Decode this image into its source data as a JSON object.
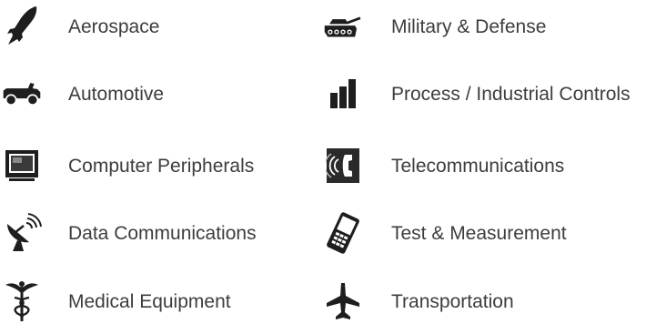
{
  "industries": {
    "left": [
      {
        "label": "Aerospace",
        "icon": "rocket-icon"
      },
      {
        "label": "Automotive",
        "icon": "car-icon"
      },
      {
        "label": "Computer Peripherals",
        "icon": "monitor-icon"
      },
      {
        "label": "Data Communications",
        "icon": "satellite-dish-icon"
      },
      {
        "label": "Medical Equipment",
        "icon": "caduceus-icon"
      }
    ],
    "right": [
      {
        "label": "Military & Defense",
        "icon": "tank-icon"
      },
      {
        "label": "Process / Industrial Controls",
        "icon": "bar-chart-icon"
      },
      {
        "label": "Telecommunications",
        "icon": "phone-icon"
      },
      {
        "label": "Test & Measurement",
        "icon": "handheld-meter-icon"
      },
      {
        "label": "Transportation",
        "icon": "airplane-icon"
      }
    ]
  },
  "colors": {
    "icon": "#1e1e1e",
    "text": "#3d3d3d",
    "background": "#ffffff"
  }
}
